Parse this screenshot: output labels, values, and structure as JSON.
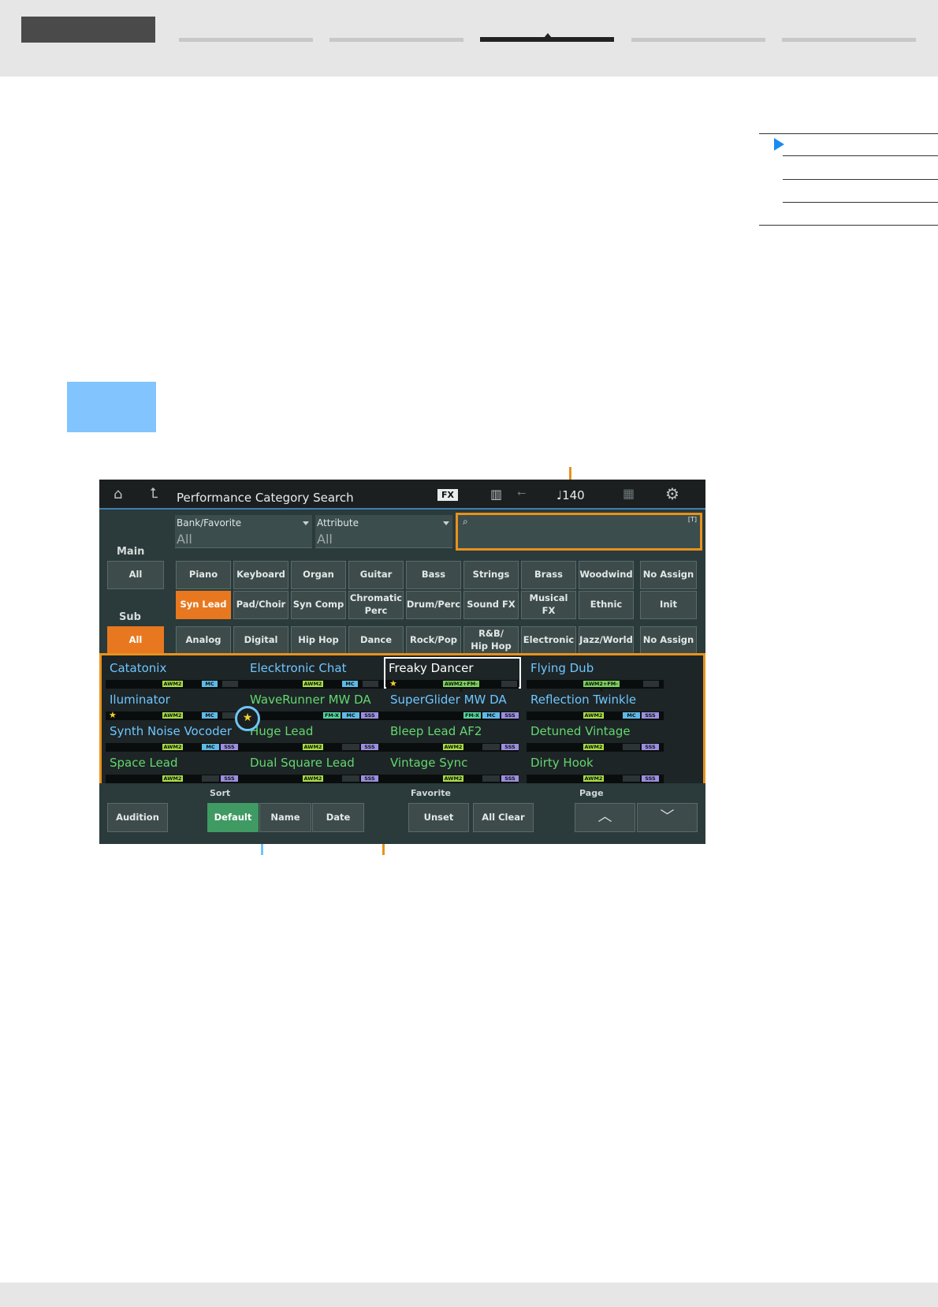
{
  "screen": {
    "title": "Performance Category Search",
    "fx_badge": "FX",
    "tempo": "♩140",
    "bank_label": "Bank/Favorite",
    "bank_value": "All",
    "attr_label": "Attribute",
    "attr_value": "All",
    "search_tag": "[T]",
    "main_label": "Main",
    "sub_label": "Sub",
    "main_all": "All",
    "main_categories": [
      "Piano",
      "Keyboard",
      "Organ",
      "Guitar",
      "Bass",
      "Strings",
      "Brass",
      "Woodwind"
    ],
    "main_categories_2": [
      "Syn Lead",
      "Pad/Choir",
      "Syn Comp",
      "Chromatic\nPerc",
      "Drum/Perc",
      "Sound FX",
      "Musical FX",
      "Ethnic"
    ],
    "main_no_assign": "No Assign",
    "main_init": "Init",
    "sub_all": "All",
    "sub_categories": [
      "Analog",
      "Digital",
      "Hip Hop",
      "Dance",
      "Rock/Pop",
      "R&B/\nHip Hop",
      "Electronic",
      "Jazz/World"
    ],
    "sub_no_assign": "No Assign",
    "selected_main": "Syn Lead",
    "results": [
      {
        "name": "Catatonix",
        "color": "blue",
        "fav": false,
        "tags": [
          "AWM2",
          "MC"
        ]
      },
      {
        "name": "Elecktronic Chat",
        "color": "blue",
        "fav": false,
        "tags": [
          "AWM2",
          "MC"
        ]
      },
      {
        "name": "Freaky Dancer",
        "color": "white",
        "fav": true,
        "tags": [
          "AWM2+FM-X"
        ]
      },
      {
        "name": "Flying Dub",
        "color": "blue",
        "fav": false,
        "tags": [
          "AWM2+FM-X"
        ]
      },
      {
        "name": "Iluminator",
        "color": "blue",
        "fav": true,
        "tags": [
          "AWM2",
          "MC"
        ]
      },
      {
        "name": "WaveRunner MW DA",
        "color": "green",
        "fav": false,
        "tags": [
          "FM-X",
          "MC",
          "SSS"
        ]
      },
      {
        "name": "SuperGlider MW DA",
        "color": "blue",
        "fav": false,
        "tags": [
          "FM-X",
          "MC",
          "SSS"
        ]
      },
      {
        "name": "Reflection Twinkle",
        "color": "blue",
        "fav": false,
        "tags": [
          "AWM2",
          "MC",
          "SSS"
        ]
      },
      {
        "name": "Synth Noise Vocoder",
        "color": "blue",
        "fav": false,
        "tags": [
          "AWM2",
          "MC",
          "SSS"
        ]
      },
      {
        "name": "Huge Lead",
        "color": "green",
        "fav": false,
        "tags": [
          "AWM2",
          "SSS"
        ]
      },
      {
        "name": "Bleep Lead AF2",
        "color": "green",
        "fav": false,
        "tags": [
          "AWM2",
          "SSS"
        ]
      },
      {
        "name": "Detuned Vintage",
        "color": "green",
        "fav": false,
        "tags": [
          "AWM2",
          "SSS"
        ]
      },
      {
        "name": "Space Lead",
        "color": "green",
        "fav": false,
        "tags": [
          "AWM2",
          "SSS"
        ]
      },
      {
        "name": "Dual Square Lead",
        "color": "green",
        "fav": false,
        "tags": [
          "AWM2",
          "SSS"
        ]
      },
      {
        "name": "Vintage Sync",
        "color": "green",
        "fav": false,
        "tags": [
          "AWM2",
          "SSS"
        ]
      },
      {
        "name": "Dirty Hook",
        "color": "green",
        "fav": false,
        "tags": [
          "AWM2",
          "SSS"
        ]
      }
    ],
    "selected_result": "Freaky Dancer",
    "audition": "Audition",
    "sort_label": "Sort",
    "sort_default": "Default",
    "sort_name": "Name",
    "sort_date": "Date",
    "favorite_label": "Favorite",
    "fav_unset": "Unset",
    "fav_all_clear": "All Clear",
    "page_label": "Page",
    "page_up": "︿",
    "page_down": "﹀"
  },
  "colors": {
    "accent_orange": "#e8921c",
    "callout_blue": "#6ec6f5",
    "toc_arrow": "#1a8cf0",
    "selected_button": "#e8781f",
    "sort_selected": "#3f9a63"
  }
}
